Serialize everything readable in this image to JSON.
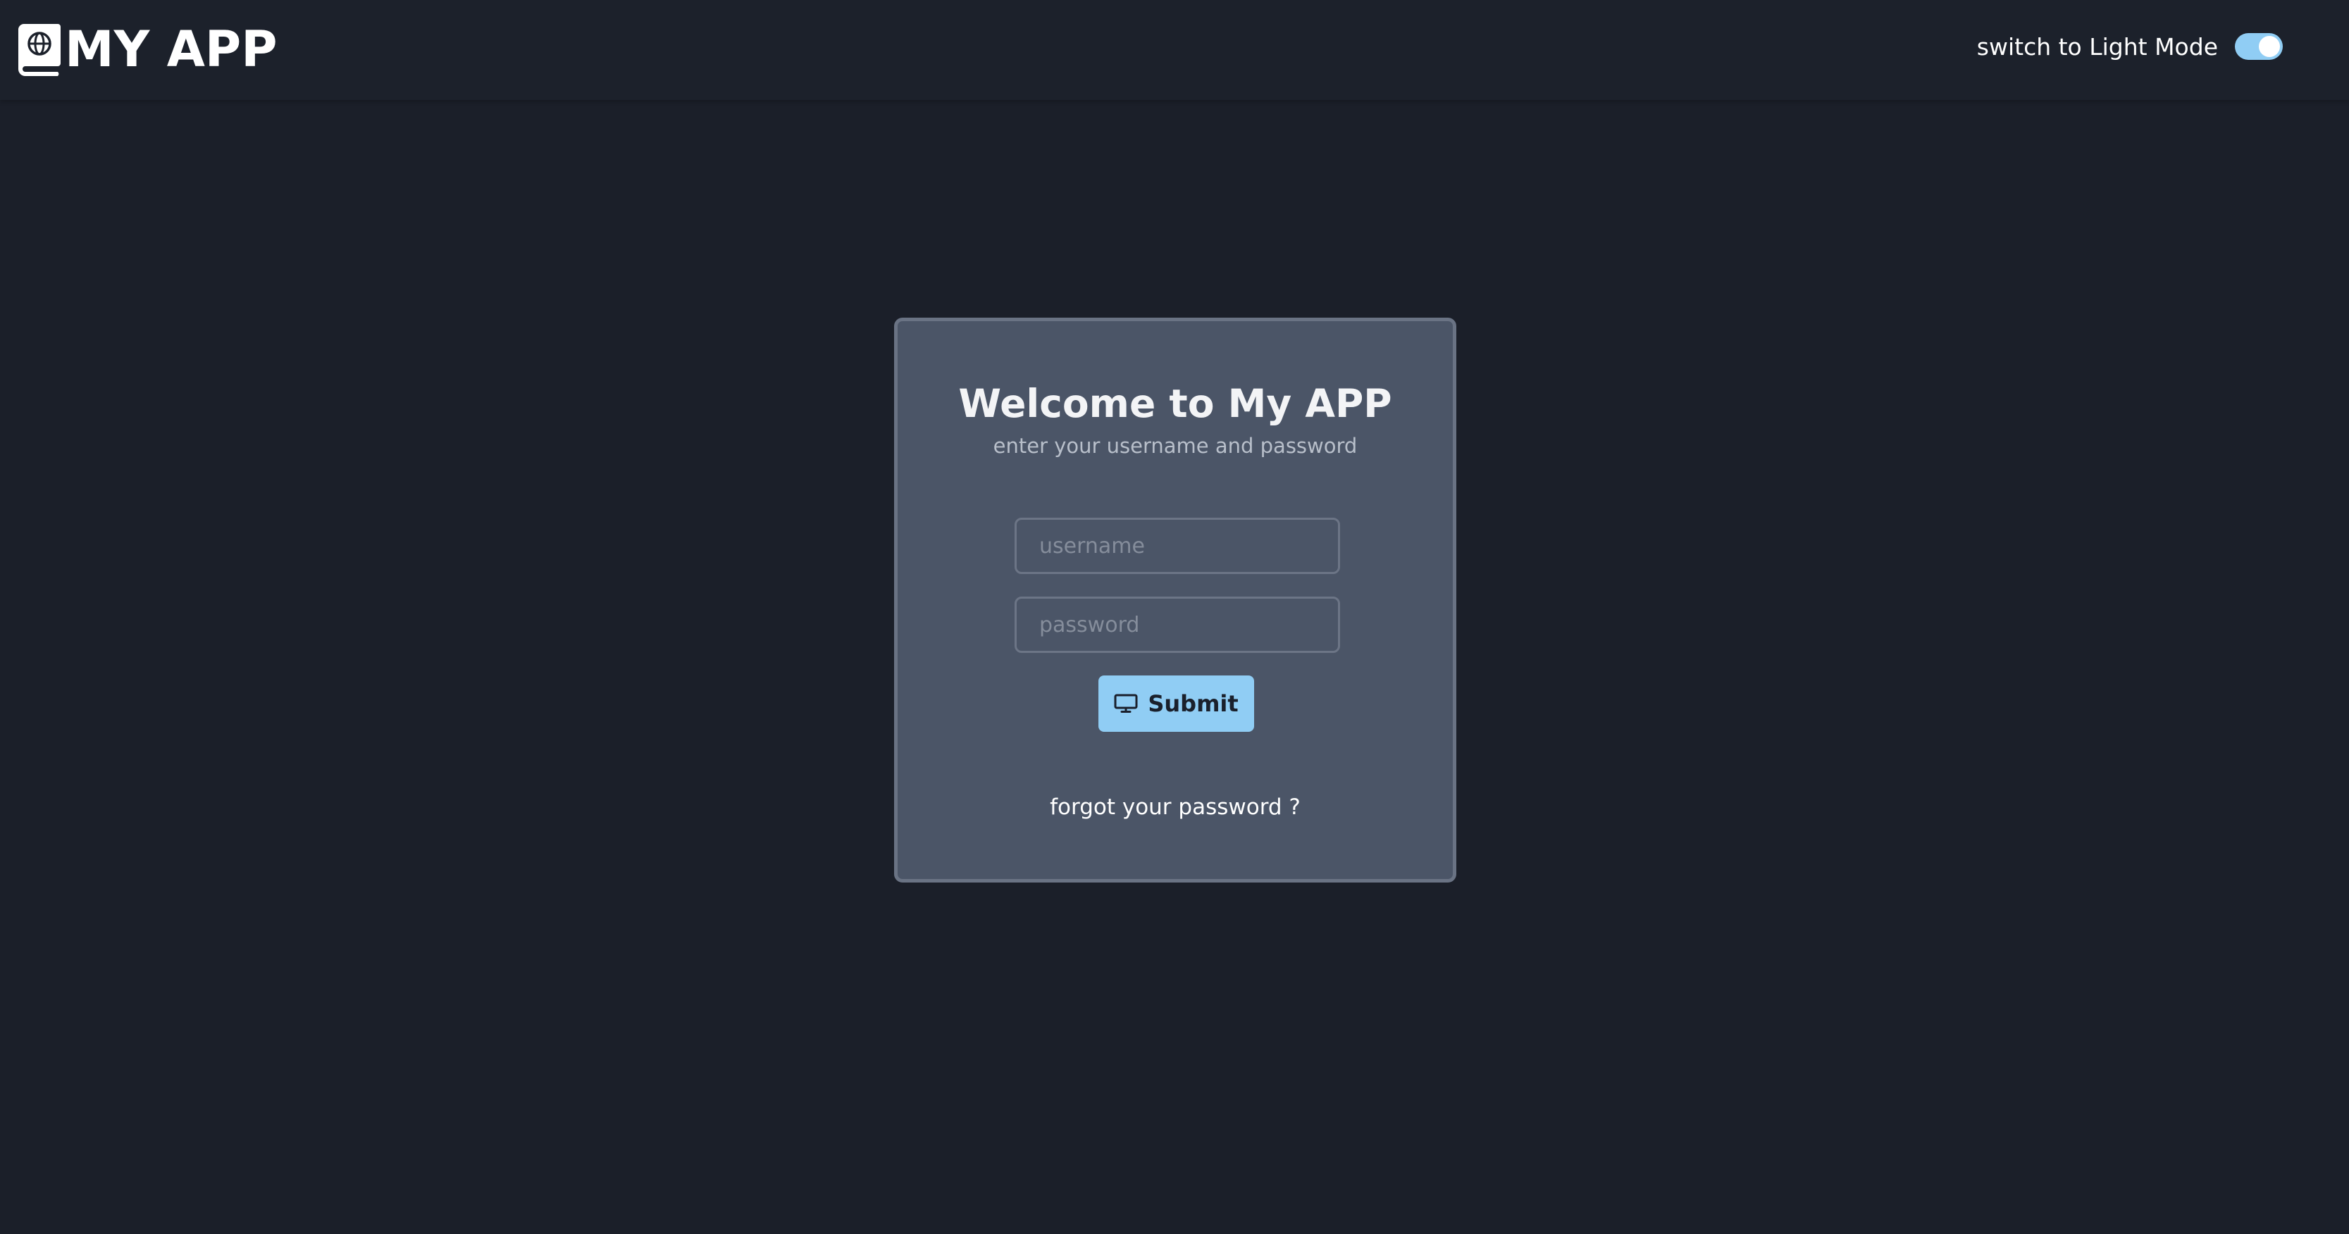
{
  "header": {
    "brand_icon": "book-globe-icon",
    "app_title": "MY APP",
    "theme_toggle": {
      "label": "switch to Light Mode",
      "checked": true,
      "color": "#90cdf4"
    }
  },
  "login": {
    "title": "Welcome to My APP",
    "subtitle": "enter your username and password",
    "username": {
      "value": "",
      "placeholder": "username"
    },
    "password": {
      "value": "",
      "placeholder": "password"
    },
    "submit": {
      "label": "Submit",
      "icon": "monitor-icon",
      "color": "#90cdf4"
    },
    "forgot_link": "forgot your password ?"
  }
}
